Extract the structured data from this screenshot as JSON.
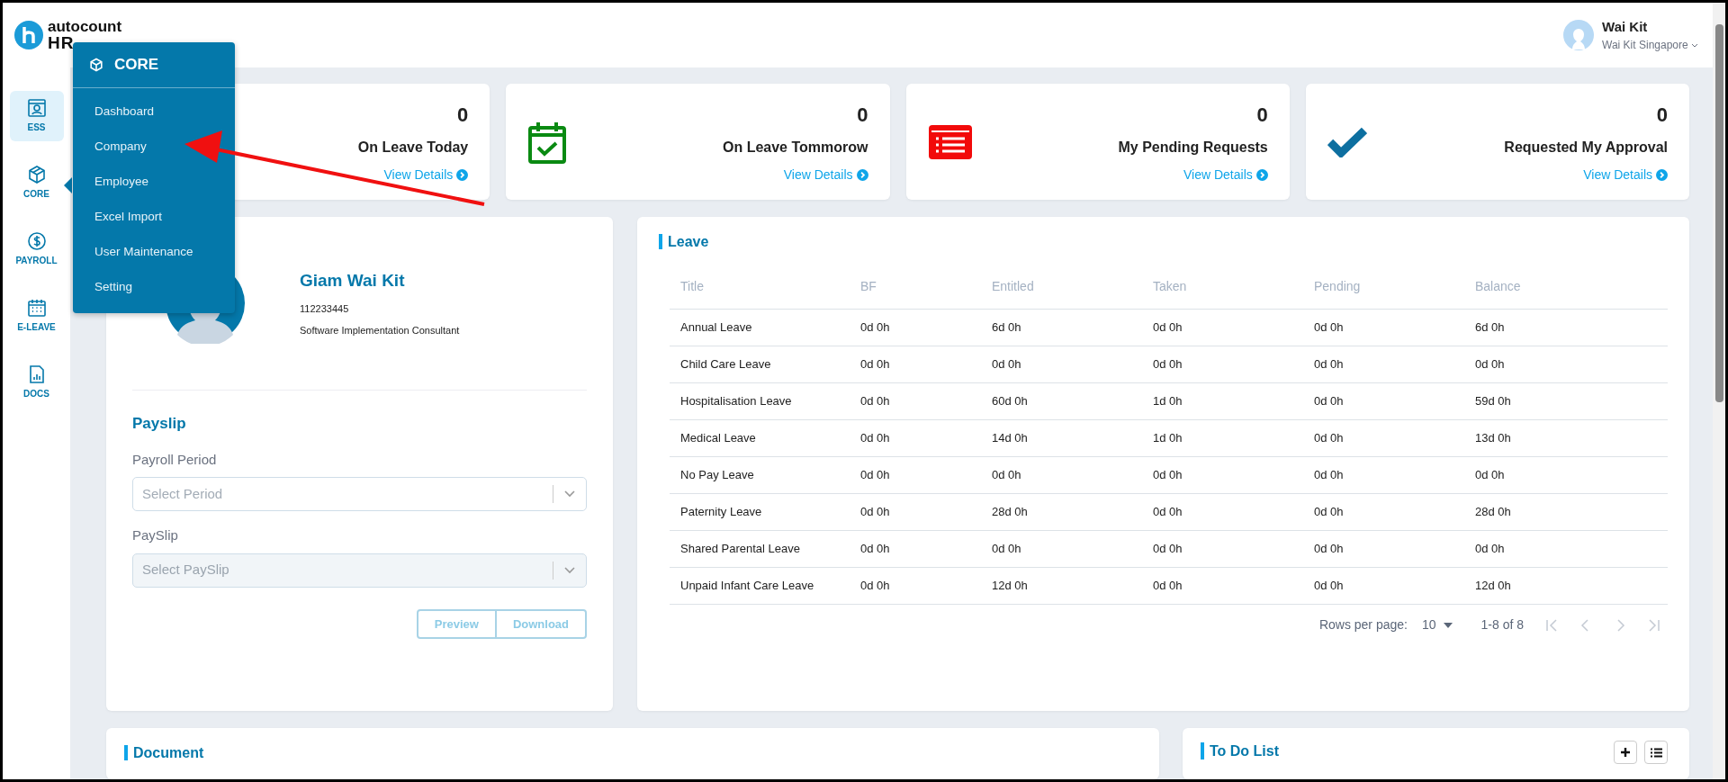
{
  "header": {
    "logo_top": "autocount",
    "logo_bottom": "HR",
    "user": {
      "name": "Wai Kit",
      "company": "Wai Kit Singapore"
    }
  },
  "sidebar": {
    "items": [
      {
        "label": "ESS",
        "selected": true,
        "expanded": false
      },
      {
        "label": "CORE",
        "selected": false,
        "expanded": true
      },
      {
        "label": "PAYROLL",
        "selected": false,
        "expanded": false
      },
      {
        "label": "E-LEAVE",
        "selected": false,
        "expanded": false
      },
      {
        "label": "DOCS",
        "selected": false,
        "expanded": false
      }
    ]
  },
  "flyout": {
    "title": "CORE",
    "items": [
      "Dashboard",
      "Company",
      "Employee",
      "Excel Import",
      "User Maintenance",
      "Setting"
    ]
  },
  "stat_cards": [
    {
      "count": "0",
      "label": "On Leave Today",
      "link": "View Details"
    },
    {
      "count": "0",
      "label": "On Leave Tommorow",
      "link": "View Details"
    },
    {
      "count": "0",
      "label": "My Pending Requests",
      "link": "View Details"
    },
    {
      "count": "0",
      "label": "Requested My Approval",
      "link": "View Details"
    }
  ],
  "profile": {
    "name": "Giam Wai Kit",
    "id": "112233445",
    "position": "Software Implementation Consultant"
  },
  "payslip": {
    "title": "Payslip",
    "fields": [
      {
        "label": "Payroll Period",
        "placeholder": "Select Period",
        "disabled": false
      },
      {
        "label": "PaySlip",
        "placeholder": "Select PaySlip",
        "disabled": true
      }
    ],
    "buttons": [
      {
        "label": "Preview",
        "disabled": true
      },
      {
        "label": "Download",
        "disabled": true
      }
    ]
  },
  "leave": {
    "title": "Leave",
    "columns": [
      "Title",
      "BF",
      "Entitled",
      "Taken",
      "Pending",
      "Balance"
    ],
    "rows": [
      [
        "Annual Leave",
        "0d 0h",
        "6d 0h",
        "0d 0h",
        "0d 0h",
        "6d 0h"
      ],
      [
        "Child Care Leave",
        "0d 0h",
        "0d 0h",
        "0d 0h",
        "0d 0h",
        "0d 0h"
      ],
      [
        "Hospitalisation Leave",
        "0d 0h",
        "60d 0h",
        "1d 0h",
        "0d 0h",
        "59d 0h"
      ],
      [
        "Medical Leave",
        "0d 0h",
        "14d 0h",
        "1d 0h",
        "0d 0h",
        "13d 0h"
      ],
      [
        "No Pay Leave",
        "0d 0h",
        "0d 0h",
        "0d 0h",
        "0d 0h",
        "0d 0h"
      ],
      [
        "Paternity Leave",
        "0d 0h",
        "28d 0h",
        "0d 0h",
        "0d 0h",
        "28d 0h"
      ],
      [
        "Shared Parental Leave",
        "0d 0h",
        "0d 0h",
        "0d 0h",
        "0d 0h",
        "0d 0h"
      ],
      [
        "Unpaid Infant Care Leave",
        "0d 0h",
        "12d 0h",
        "0d 0h",
        "0d 0h",
        "12d 0h"
      ]
    ],
    "pagination": {
      "rows_per_page_label": "Rows per page:",
      "rows_per_page": "10",
      "range": "1-8 of 8"
    }
  },
  "document": {
    "title": "Document"
  },
  "todo": {
    "title": "To Do List"
  }
}
